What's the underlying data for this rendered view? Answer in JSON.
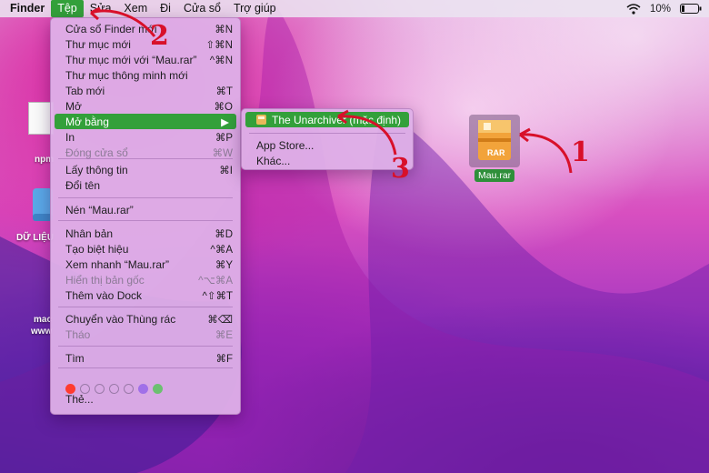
{
  "menubar": {
    "items": [
      "Finder",
      "Tệp",
      "Sửa",
      "Xem",
      "Đi",
      "Cửa sổ",
      "Trợ giúp"
    ],
    "battery": "10%"
  },
  "file_menu": {
    "items": [
      {
        "label": "Cửa sổ Finder mới",
        "shortcut": "⌘N"
      },
      {
        "label": "Thư mục mới",
        "shortcut": "⇧⌘N"
      },
      {
        "label": "Thư mục mới với “Mau.rar”",
        "shortcut": "^⌘N"
      },
      {
        "label": "Thư mục thông minh mới",
        "shortcut": ""
      },
      {
        "label": "Tab mới",
        "shortcut": "⌘T"
      },
      {
        "label": "Mở",
        "shortcut": "⌘O"
      },
      {
        "label": "Mở bằng",
        "shortcut": "▶"
      },
      {
        "label": "In",
        "shortcut": "⌘P"
      },
      {
        "label": "Đóng cửa sổ",
        "shortcut": "⌘W"
      },
      {
        "label": "Lấy thông tin",
        "shortcut": "⌘I"
      },
      {
        "label": "Đổi tên",
        "shortcut": ""
      },
      {
        "label": "Nén “Mau.rar”",
        "shortcut": ""
      },
      {
        "label": "Nhân bản",
        "shortcut": "⌘D"
      },
      {
        "label": "Tạo biệt hiệu",
        "shortcut": "^⌘A"
      },
      {
        "label": "Xem nhanh “Mau.rar”",
        "shortcut": "⌘Y"
      },
      {
        "label": "Hiển thị bản gốc",
        "shortcut": "^⌥⌘A"
      },
      {
        "label": "Thêm vào Dock",
        "shortcut": "^⇧⌘T"
      },
      {
        "label": "Chuyển vào Thùng rác",
        "shortcut": "⌘⌫"
      },
      {
        "label": "Tháo",
        "shortcut": "⌘E"
      },
      {
        "label": "Tìm",
        "shortcut": "⌘F"
      },
      {
        "label": "Thẻ...",
        "shortcut": ""
      }
    ],
    "tag_colors": [
      "#ff3b30",
      "none",
      "none",
      "none",
      "none",
      "#a070e8",
      "#6cc070"
    ]
  },
  "open_with_submenu": {
    "items": [
      {
        "label": "The Unarchiver (mặc định)"
      },
      {
        "label": "App Store..."
      },
      {
        "label": "Khác..."
      }
    ]
  },
  "desktop": {
    "left_labels": [
      "npm",
      "DỮ LIỆU",
      "mac",
      "www"
    ],
    "file_name": "Mau.rar",
    "file_badge": "RAR"
  },
  "annotations": {
    "step1": "1",
    "step2": "2",
    "step3": "3"
  },
  "colors": {
    "highlight": "#33a03a",
    "annotation": "#d8102a"
  }
}
